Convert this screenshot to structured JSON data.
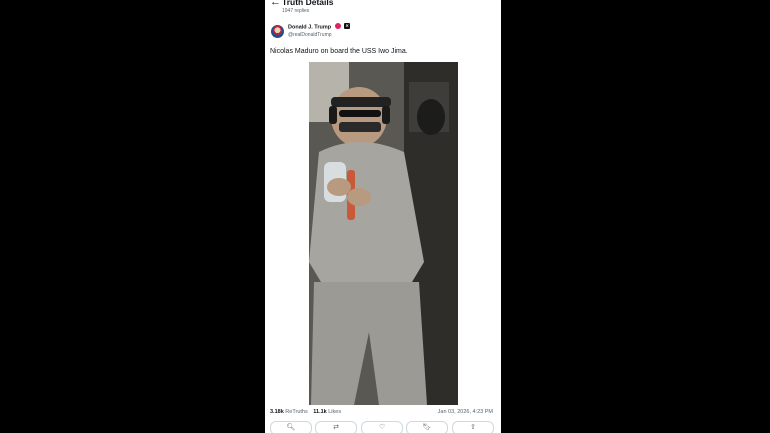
{
  "header": {
    "back_icon": "arrow-left-icon",
    "title": "Truth Details",
    "subtitle": "1947 replies",
    "more_icon": "more-horizontal-icon"
  },
  "post": {
    "author_name": "Donald J. Trump",
    "handle": "@realDonaldTrump",
    "text": "Nicolas Maduro on board the USS Iwo Jima.",
    "image_icon": "photo",
    "retruths_count": "3.18k",
    "retruths_label": "ReTruths",
    "likes_count": "11.1k",
    "likes_label": "Likes",
    "timestamp": "Jan 03, 2026, 4:23 PM"
  },
  "actions": [
    {
      "icon": "comment-icon",
      "glyph": "🔍︎"
    },
    {
      "icon": "retruth-icon",
      "glyph": "⇄"
    },
    {
      "icon": "heart-icon",
      "glyph": "♡"
    },
    {
      "icon": "bookmark-icon",
      "glyph": "🔖︎"
    },
    {
      "icon": "share-icon",
      "glyph": "⇧"
    }
  ],
  "colors": {
    "accent": "#e0245e",
    "muted": "#536471",
    "background": "#000000"
  }
}
